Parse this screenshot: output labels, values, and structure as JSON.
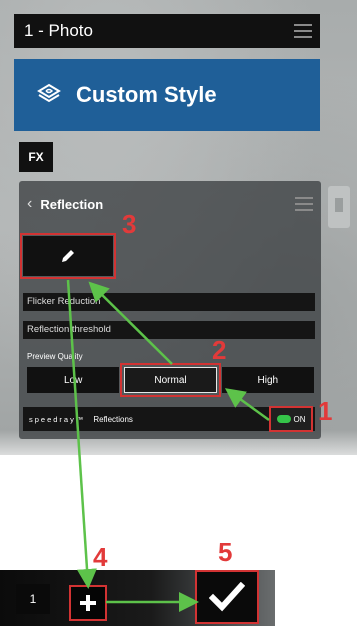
{
  "topbar": {
    "title": "1 - Photo"
  },
  "style_header": {
    "label": "Custom Style"
  },
  "fx_label": "FX",
  "panel": {
    "title": "Reflection",
    "fields": [
      "Flicker Reduction",
      "Reflection threshold"
    ],
    "preview_quality_label": "Preview Quality",
    "quality_options": [
      "Low",
      "Normal",
      "High"
    ],
    "quality_selected": "Normal",
    "speedray": {
      "brand": "speedray™",
      "label": "Reflections",
      "toggle_text": "ON"
    }
  },
  "bottom": {
    "page_number": "1"
  },
  "annotations": [
    "1",
    "2",
    "3",
    "4",
    "5"
  ],
  "colors": {
    "annotation_red": "#d23333",
    "arrow_green": "#5dc24a",
    "brand_blue": "#1f5f98",
    "toggle_green": "#35c449"
  },
  "icons": [
    "menu-icon",
    "custom-style-logo-icon",
    "chevron-left-icon",
    "pencil-icon",
    "plus-icon",
    "checkmark-icon"
  ]
}
